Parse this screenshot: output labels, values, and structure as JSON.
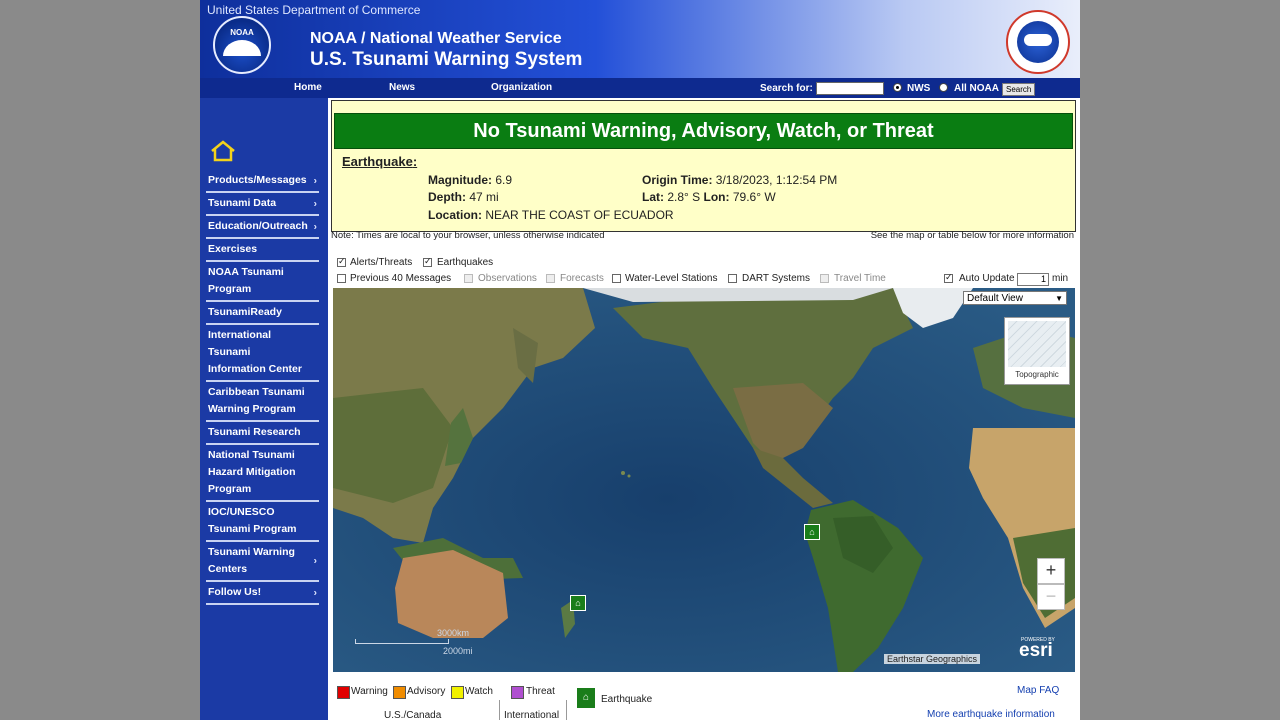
{
  "header": {
    "department": "United States Department of Commerce",
    "logo_text": "NOAA",
    "title_line1": "NOAA / National Weather Service",
    "title_line2": "U.S. Tsunami Warning System"
  },
  "nav": {
    "links": [
      "Home",
      "News",
      "Organization"
    ],
    "search_label": "Search for:",
    "search_value": "",
    "radio_nws": "NWS",
    "radio_all": "All NOAA",
    "search_button": "Search"
  },
  "sidebar": {
    "items": [
      {
        "label": "Products/Messages",
        "arrow": "›"
      },
      {
        "label": "Tsunami Data",
        "arrow": "›"
      },
      {
        "label": "Education/Outreach",
        "arrow": "›"
      },
      {
        "label": "Exercises",
        "arrow": ""
      },
      {
        "label": "NOAA Tsunami Program",
        "arrow": ""
      },
      {
        "label": "TsunamiReady",
        "arrow": ""
      },
      {
        "label": "International Tsunami Information Center",
        "arrow": ""
      },
      {
        "label": "Caribbean Tsunami Warning Program",
        "arrow": ""
      },
      {
        "label": "Tsunami Research",
        "arrow": ""
      },
      {
        "label": "National Tsunami Hazard Mitigation Program",
        "arrow": ""
      },
      {
        "label": "IOC/UNESCO Tsunami Program",
        "arrow": ""
      },
      {
        "label": "Tsunami Warning Centers",
        "arrow": "›"
      },
      {
        "label": "Follow Us!",
        "arrow": "›"
      }
    ]
  },
  "alert": {
    "banner": "No Tsunami Warning, Advisory, Watch, or Threat",
    "banner_color": "#0a7d12",
    "eq_heading": "Earthquake",
    "magnitude_label": "Magnitude:",
    "magnitude": "6.9",
    "depth_label": "Depth:",
    "depth": "47 mi",
    "location_label": "Location:",
    "location": "NEAR THE COAST OF ECUADOR",
    "origin_label": "Origin Time:",
    "origin_time": "3/18/2023, 1:12:54 PM",
    "lat_label": "Lat:",
    "lat": "2.8° S",
    "lon_label": "Lon:",
    "lon": "79.6° W"
  },
  "notes": {
    "left": "Note: Times are local to your browser, unless otherwise indicated",
    "right": "See the map or table below for more information"
  },
  "layers": {
    "alerts": "Alerts/Threats",
    "earthquakes": "Earthquakes",
    "previous": "Previous 40 Messages",
    "observations": "Observations",
    "forecasts": "Forecasts",
    "water_level": "Water-Level Stations",
    "dart": "DART Systems",
    "travel_time": "Travel Time",
    "auto_update": "Auto Update",
    "auto_update_value": "1",
    "auto_update_unit": "min"
  },
  "map": {
    "view_select": "Default View",
    "basemap_label": "Topographic",
    "zoom_in": "+",
    "zoom_out": "−",
    "scale_km": "3000km",
    "scale_mi": "2000mi",
    "attribution": "Earthstar Geographics",
    "esri_powered": "POWERED BY",
    "esri": "esri",
    "marker_icon": "tsunami-earthquake-icon"
  },
  "legend": {
    "warning": "Warning",
    "advisory": "Advisory",
    "watch": "Watch",
    "threat": "Threat",
    "earthquake": "Earthquake",
    "us_canada": "U.S./Canada",
    "international": "International",
    "colors": {
      "warning": "#e00000",
      "advisory": "#f08c00",
      "watch": "#f2f200",
      "threat": "#b04fd0"
    }
  },
  "links": {
    "map_faq": "Map FAQ",
    "more_eq": "More earthquake information"
  }
}
